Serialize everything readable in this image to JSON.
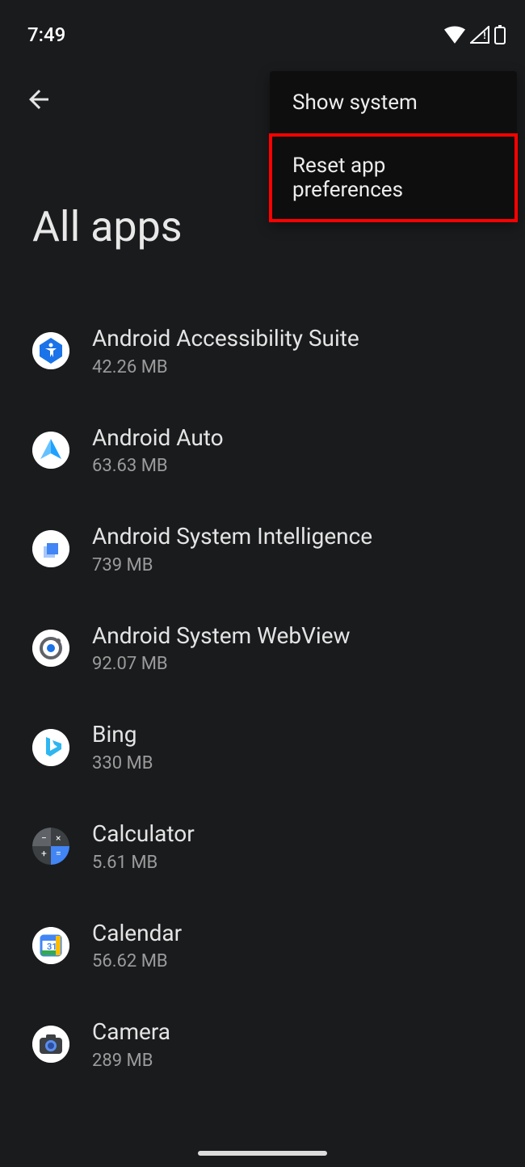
{
  "status_bar": {
    "time": "7:49"
  },
  "header": {
    "title": "All apps"
  },
  "menu": {
    "items": [
      {
        "label": "Show system",
        "highlight": false
      },
      {
        "label": "Reset app preferences",
        "highlight": true
      }
    ]
  },
  "apps": [
    {
      "name": "Android Accessibility Suite",
      "size": "42.26 MB",
      "icon": "accessibility"
    },
    {
      "name": "Android Auto",
      "size": "63.63 MB",
      "icon": "android-auto"
    },
    {
      "name": "Android System Intelligence",
      "size": "739 MB",
      "icon": "system-intel"
    },
    {
      "name": "Android System WebView",
      "size": "92.07 MB",
      "icon": "webview"
    },
    {
      "name": "Bing",
      "size": "330 MB",
      "icon": "bing"
    },
    {
      "name": "Calculator",
      "size": "5.61 MB",
      "icon": "calculator"
    },
    {
      "name": "Calendar",
      "size": "56.62 MB",
      "icon": "calendar"
    },
    {
      "name": "Camera",
      "size": "289 MB",
      "icon": "camera"
    }
  ]
}
